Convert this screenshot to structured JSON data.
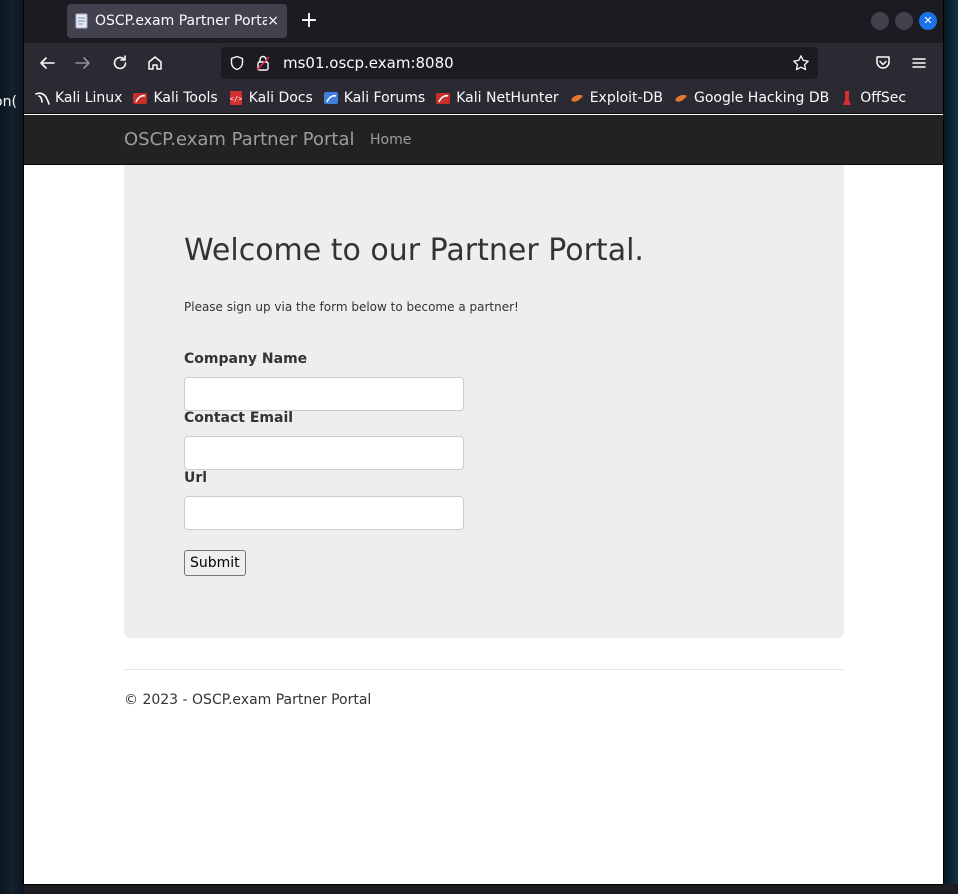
{
  "desktop": {
    "fragment_text": "on("
  },
  "browser": {
    "tab": {
      "title": "OSCP.exam Partner Portal",
      "close_glyph": "×",
      "favicon": "document-icon"
    },
    "new_tab_glyph": "+",
    "url": "ms01.oscp.exam:8080",
    "bookmarks": [
      {
        "label": "Kali Linux",
        "icon": "kali-dragon-icon"
      },
      {
        "label": "Kali Tools",
        "icon": "kali-tools-icon"
      },
      {
        "label": "Kali Docs",
        "icon": "kali-docs-icon"
      },
      {
        "label": "Kali Forums",
        "icon": "kali-forums-icon"
      },
      {
        "label": "Kali NetHunter",
        "icon": "kali-nethunter-icon"
      },
      {
        "label": "Exploit-DB",
        "icon": "exploit-db-icon"
      },
      {
        "label": "Google Hacking DB",
        "icon": "ghdb-icon"
      },
      {
        "label": "OffSec",
        "icon": "offsec-icon"
      }
    ]
  },
  "site": {
    "brand": "OSCP.exam Partner Portal",
    "nav_home": "Home",
    "heading": "Welcome to our Partner Portal.",
    "lead": "Please sign up via the form below to become a partner!",
    "form": {
      "company_label": "Company Name",
      "email_label": "Contact Email",
      "url_label": "Url",
      "company_value": "",
      "email_value": "",
      "url_value": "",
      "submit_label": "Submit"
    },
    "footer": "© 2023 - OSCP.exam Partner Portal"
  },
  "colors": {
    "tab_bar": "#1c1b22",
    "toolbar": "#2b2a33",
    "site_navbar": "#222222",
    "jumbotron": "#eeeeee",
    "close_button": "#1a73e8"
  }
}
